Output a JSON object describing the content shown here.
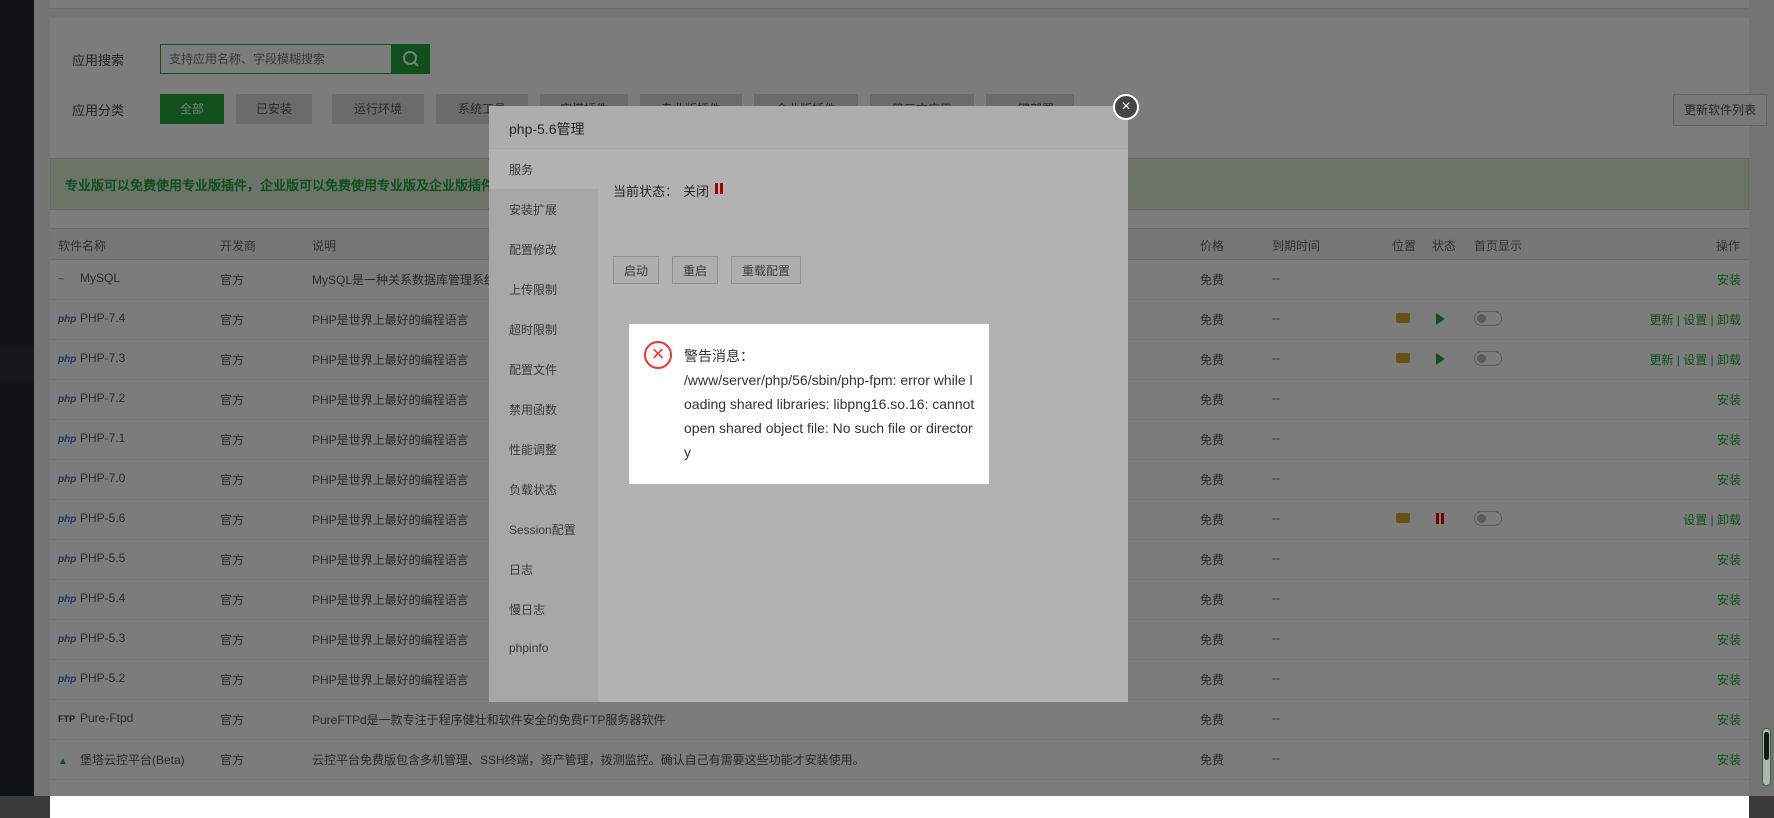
{
  "search": {
    "label": "应用搜索",
    "placeholder": "支持应用名称、字段模糊搜索"
  },
  "category": {
    "label": "应用分类",
    "items": [
      "全部",
      "已安装",
      "运行环境",
      "系统工具",
      "宝塔插件",
      "专业版插件",
      "企业版插件",
      "第三方应用",
      "一键部署"
    ]
  },
  "update_button": "更新软件列表",
  "notice": "专业版可以免费使用专业版插件，企业版可以免费使用专业版及企业版插件",
  "table": {
    "headers": [
      "软件名称",
      "开发商",
      "说明",
      "价格",
      "到期时间",
      "位置",
      "状态",
      "首页显示",
      "操作"
    ],
    "rows": [
      {
        "icon": "",
        "name": "MySQL",
        "vendor": "官方",
        "desc": "MySQL是一种关系数据库管理系统",
        "price": "免费",
        "expire": "--",
        "action": "安装",
        "installed": false
      },
      {
        "icon": "php",
        "name": "PHP-7.4",
        "vendor": "官方",
        "desc": "PHP是世界上最好的编程语言",
        "price": "免费",
        "expire": "--",
        "action": "更新 | 设置 | 卸载",
        "installed": true,
        "running": true
      },
      {
        "icon": "php",
        "name": "PHP-7.3",
        "vendor": "官方",
        "desc": "PHP是世界上最好的编程语言",
        "price": "免费",
        "expire": "--",
        "action": "更新 | 设置 | 卸载",
        "installed": true,
        "running": true
      },
      {
        "icon": "php",
        "name": "PHP-7.2",
        "vendor": "官方",
        "desc": "PHP是世界上最好的编程语言",
        "price": "免费",
        "expire": "--",
        "action": "安装",
        "installed": false
      },
      {
        "icon": "php",
        "name": "PHP-7.1",
        "vendor": "官方",
        "desc": "PHP是世界上最好的编程语言",
        "price": "免费",
        "expire": "--",
        "action": "安装",
        "installed": false
      },
      {
        "icon": "php",
        "name": "PHP-7.0",
        "vendor": "官方",
        "desc": "PHP是世界上最好的编程语言",
        "price": "免费",
        "expire": "--",
        "action": "安装",
        "installed": false
      },
      {
        "icon": "php",
        "name": "PHP-5.6",
        "vendor": "官方",
        "desc": "PHP是世界上最好的编程语言",
        "price": "免费",
        "expire": "--",
        "action": "设置 | 卸载",
        "installed": true,
        "running": false
      },
      {
        "icon": "php",
        "name": "PHP-5.5",
        "vendor": "官方",
        "desc": "PHP是世界上最好的编程语言",
        "price": "免费",
        "expire": "--",
        "action": "安装",
        "installed": false
      },
      {
        "icon": "php",
        "name": "PHP-5.4",
        "vendor": "官方",
        "desc": "PHP是世界上最好的编程语言",
        "price": "免费",
        "expire": "--",
        "action": "安装",
        "installed": false
      },
      {
        "icon": "php",
        "name": "PHP-5.3",
        "vendor": "官方",
        "desc": "PHP是世界上最好的编程语言",
        "price": "免费",
        "expire": "--",
        "action": "安装",
        "installed": false
      },
      {
        "icon": "php",
        "name": "PHP-5.2",
        "vendor": "官方",
        "desc": "PHP是世界上最好的编程语言",
        "price": "免费",
        "expire": "--",
        "action": "安装",
        "installed": false
      },
      {
        "icon": "FTP",
        "name": "Pure-Ftpd",
        "vendor": "官方",
        "desc": "PureFTPd是一款专注于程序健壮和软件安全的免费FTP服务器软件",
        "price": "免费",
        "expire": "--",
        "action": "安装",
        "installed": false
      },
      {
        "icon": "",
        "name": "堡塔云控平台(Beta)",
        "vendor": "官方",
        "desc": "云控平台免费版包含多机管理、SSH终端，资产管理，拨测监控。确认自己有需要这些功能才安装使用。",
        "price": "免费",
        "expire": "--",
        "action": "安装",
        "installed": false
      }
    ]
  },
  "dialog": {
    "title": "php-5.6管理",
    "nav": [
      "服务",
      "安装扩展",
      "配置修改",
      "上传限制",
      "超时限制",
      "配置文件",
      "禁用函数",
      "性能调整",
      "负载状态",
      "Session配置",
      "日志",
      "慢日志",
      "phpinfo"
    ],
    "status_label": "当前状态：",
    "status_value": "关闭",
    "buttons": [
      "启动",
      "重启",
      "重载配置"
    ]
  },
  "alert": {
    "title": "警告消息：",
    "message": "/www/server/php/56/sbin/php-fpm: error while loading shared libraries: libpng16.so.16: cannot open shared object file: No such file or directory"
  },
  "colors": {
    "accent": "#20a53a",
    "danger": "#e33333",
    "folder": "#d9a52b"
  }
}
